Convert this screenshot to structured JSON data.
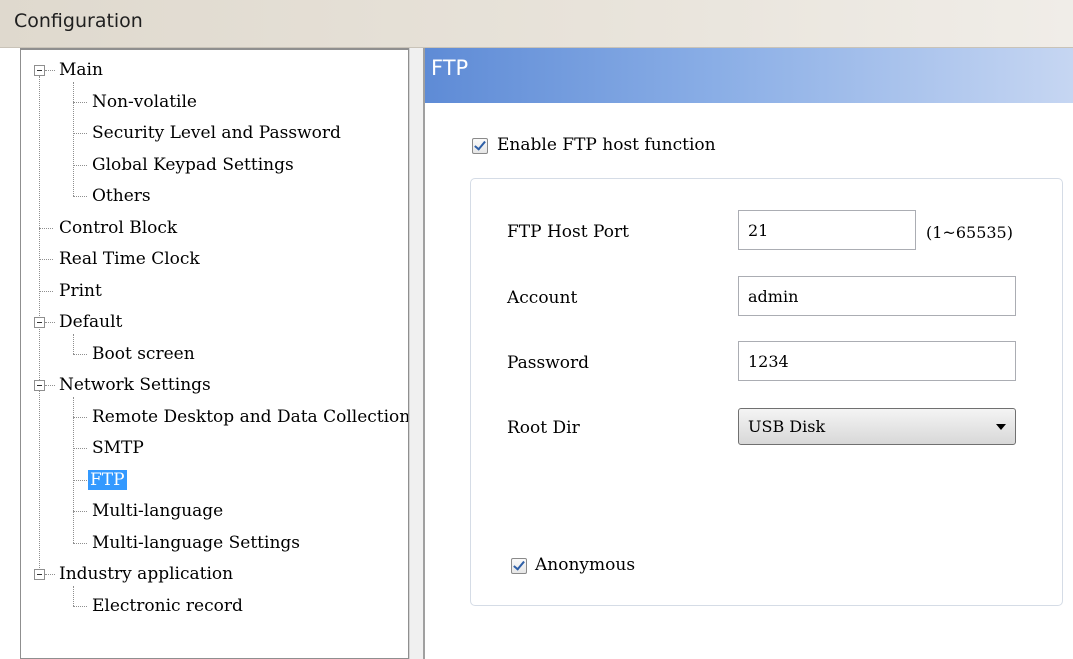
{
  "window": {
    "title": "Configuration"
  },
  "tree": {
    "main": "Main",
    "non_volatile": "Non-volatile",
    "security": "Security Level and Password",
    "global_keypad": "Global Keypad Settings",
    "others": "Others",
    "control_block": "Control Block",
    "real_time_clock": "Real Time Clock",
    "print": "Print",
    "default": "Default",
    "boot_screen": "Boot screen",
    "network_settings": "Network Settings",
    "remote_desktop": "Remote Desktop and Data Collection",
    "smtp": "SMTP",
    "ftp": "FTP",
    "multi_language": "Multi-language",
    "multi_language_settings": "Multi-language Settings",
    "industry_application": "Industry application",
    "electronic_record": "Electronic record",
    "selected": "FTP"
  },
  "panel": {
    "header": "FTP",
    "enable_label": "Enable FTP host function",
    "enable_checked": true,
    "port_label": "FTP Host Port",
    "port_value": "21",
    "port_range": "(1~65535)",
    "account_label": "Account",
    "account_value": "admin",
    "password_label": "Password",
    "password_value": "1234",
    "rootdir_label": "Root Dir",
    "rootdir_value": "USB Disk",
    "anonymous_label": "Anonymous",
    "anonymous_checked": true
  },
  "colors": {
    "header_blue": "#5e8bd6",
    "selection": "#3399ff"
  }
}
